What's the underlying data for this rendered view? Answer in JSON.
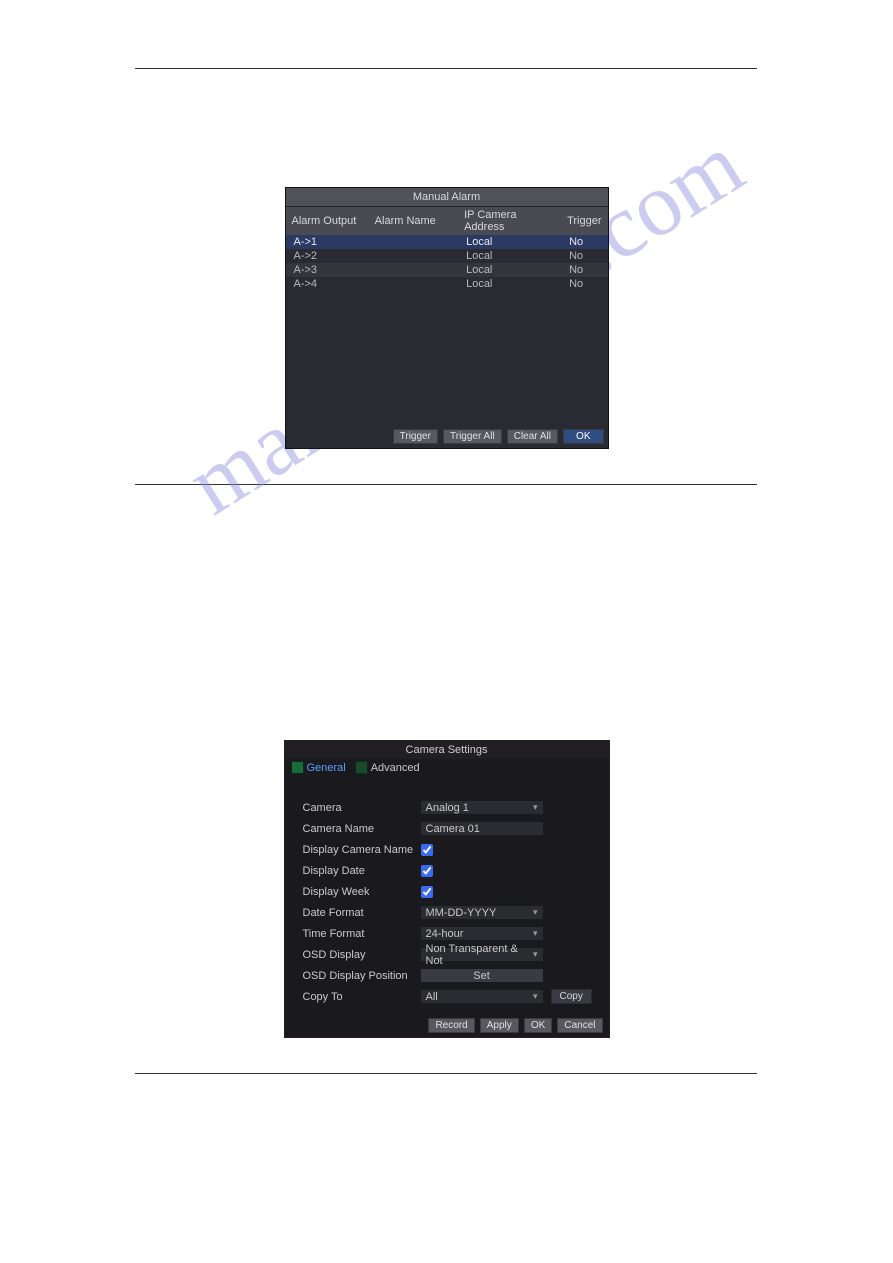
{
  "watermark": "manualshive.com",
  "manualAlarm": {
    "title": "Manual Alarm",
    "columns": {
      "c0": "Alarm Output",
      "c1": "Alarm Name",
      "c2": "IP Camera Address",
      "c3": "Trigger"
    },
    "rows": [
      {
        "out": "A->1",
        "name": "",
        "addr": "Local",
        "trig": "No"
      },
      {
        "out": "A->2",
        "name": "",
        "addr": "Local",
        "trig": "No"
      },
      {
        "out": "A->3",
        "name": "",
        "addr": "Local",
        "trig": "No"
      },
      {
        "out": "A->4",
        "name": "",
        "addr": "Local",
        "trig": "No"
      }
    ],
    "buttons": {
      "trigger": "Trigger",
      "triggerAll": "Trigger All",
      "clearAll": "Clear All",
      "ok": "OK"
    }
  },
  "cameraSettings": {
    "title": "Camera Settings",
    "tabs": {
      "general": "General",
      "advanced": "Advanced"
    },
    "labels": {
      "camera": "Camera",
      "cameraName": "Camera Name",
      "displayCameraName": "Display Camera Name",
      "displayDate": "Display Date",
      "displayWeek": "Display Week",
      "dateFormat": "Date Format",
      "timeFormat": "Time Format",
      "osdDisplay": "OSD Display",
      "osdDisplayPosition": "OSD Display Position",
      "copyTo": "Copy To"
    },
    "values": {
      "camera": "Analog 1",
      "cameraName": "Camera 01",
      "dateFormat": "MM-DD-YYYY",
      "timeFormat": "24-hour",
      "osdDisplay": "Non Transparent & Not",
      "osdPositionBtn": "Set",
      "copyTo": "All"
    },
    "buttons": {
      "copy": "Copy",
      "record": "Record",
      "apply": "Apply",
      "ok": "OK",
      "cancel": "Cancel"
    }
  }
}
